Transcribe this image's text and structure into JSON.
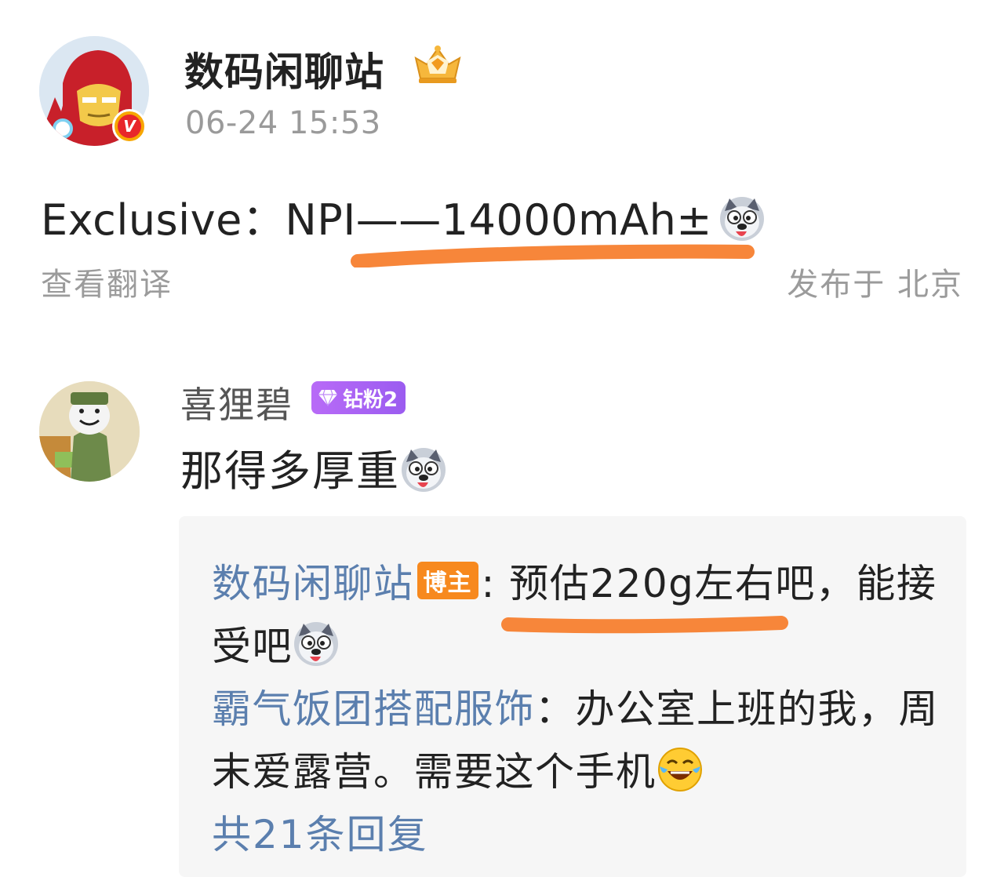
{
  "post": {
    "author": "数码闲聊站",
    "time": "06-24 15:53",
    "text": "Exclusive：NPI——14000mAh±",
    "translate": "查看翻译",
    "location": "发布于 北京"
  },
  "comment": {
    "name": "喜狸碧",
    "badge": "钻粉2",
    "text": "那得多厚重"
  },
  "replies": [
    {
      "name": "数码闲聊站",
      "badge": "博主",
      "sep": ":",
      "line1": " 预估220g左右吧，能接",
      "line2": "受吧"
    },
    {
      "name": "霸气饭团搭配服饰",
      "sep": "：",
      "line1": "办公室上班的我，周",
      "line2": "末爱露营。需要这个手机"
    }
  ],
  "more_replies": "共21条回复",
  "colors": {
    "accent_link": "#5b7fae",
    "highlight_underline": "#f7863a",
    "host_badge": "#f7891e",
    "fan_badge": "#a865f4"
  },
  "icons": [
    "verified-v-icon",
    "crown-level-icon",
    "husky-emoji-icon",
    "laugh-cry-emoji-icon",
    "diamond-icon"
  ]
}
